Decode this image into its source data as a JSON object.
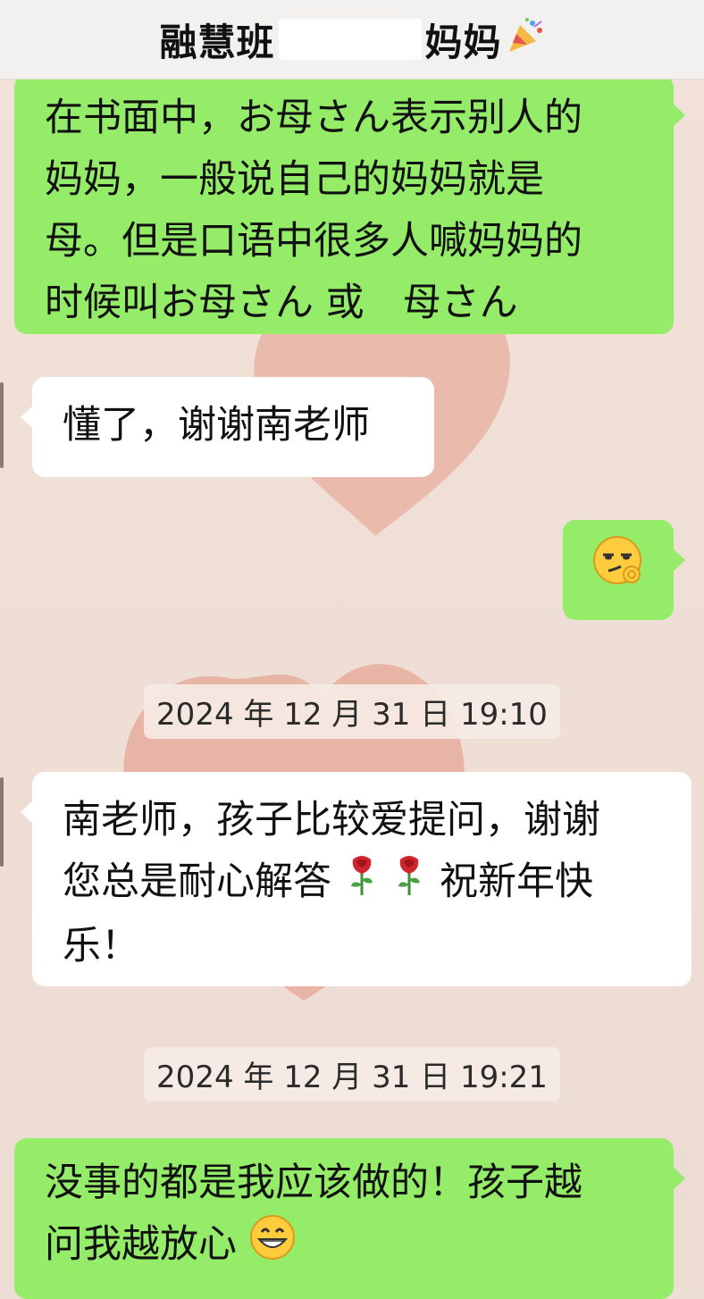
{
  "header": {
    "title_left": "融慧班",
    "title_right": "妈妈",
    "party_icon": "party-popper-icon"
  },
  "messages": [
    {
      "side": "right",
      "lines": [
        "在书面中，お母さん表示别人的",
        "妈妈，一般说自己的妈妈就是",
        "母。但是口语中很多人喊妈妈的",
        "时候叫お母さん 或　母さん"
      ]
    },
    {
      "side": "left",
      "lines": [
        "懂了，谢谢南老师"
      ]
    },
    {
      "side": "right",
      "emoji": "smirk-face-icon"
    },
    {
      "timestamp": "2024 年 12 月 31 日 19:10"
    },
    {
      "side": "left",
      "lines": [
        "南老师，孩子比较爱提问，谢谢",
        "您总是耐心解答",
        "祝新年快",
        "乐！"
      ],
      "emoji": [
        "rose-icon",
        "rose-icon"
      ]
    },
    {
      "timestamp": "2024 年 12 月 31 日 19:21"
    },
    {
      "side": "right",
      "lines": [
        "没事的都是我应该做的！孩子越",
        "问我越放心"
      ],
      "emoji": "grinning-face-icon"
    }
  ],
  "colors": {
    "green_bubble": "#95ec69",
    "white_bubble": "#ffffff",
    "chat_bg": "#eedfd6",
    "heart": "#e8907f"
  }
}
